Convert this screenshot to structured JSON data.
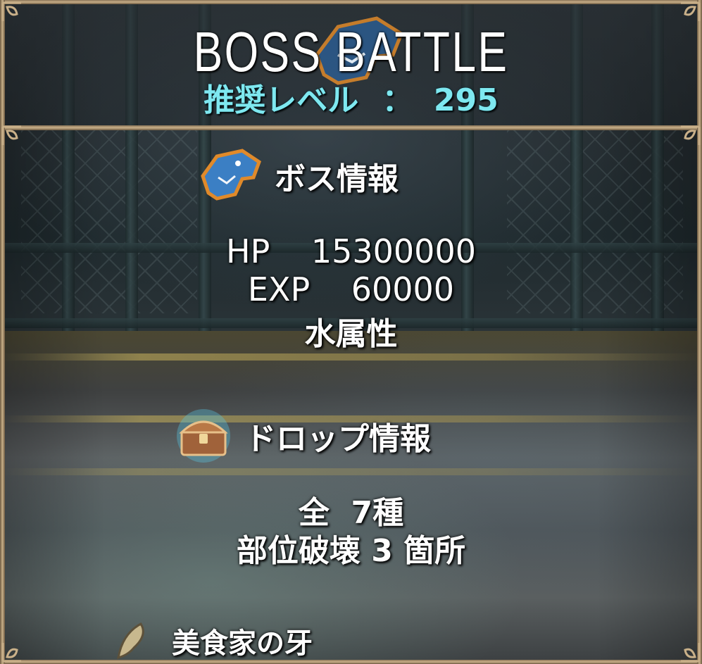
{
  "header": {
    "title": "BOSS BATTLE",
    "level_label": "推奨レベル",
    "level_separator": "：",
    "level_value": "295"
  },
  "boss_info": {
    "title": "ボス情報",
    "icon": "shark-emblem-icon",
    "hp_label": "HP",
    "hp_value": "15300000",
    "exp_label": "EXP",
    "exp_value": "60000",
    "attribute": "水属性"
  },
  "drop_info": {
    "title": "ドロップ情報",
    "icon": "treasure-chest-icon",
    "total_prefix": "全",
    "total_value": "7種",
    "break_label": "部位破壊",
    "break_count": "3",
    "break_suffix": "箇所"
  },
  "drop_items": [
    {
      "icon": "fang-icon",
      "name": "美食家の牙"
    }
  ],
  "colors": {
    "title": "#ffffff",
    "level": "#7ee8f0",
    "frame": "#c9b089"
  }
}
